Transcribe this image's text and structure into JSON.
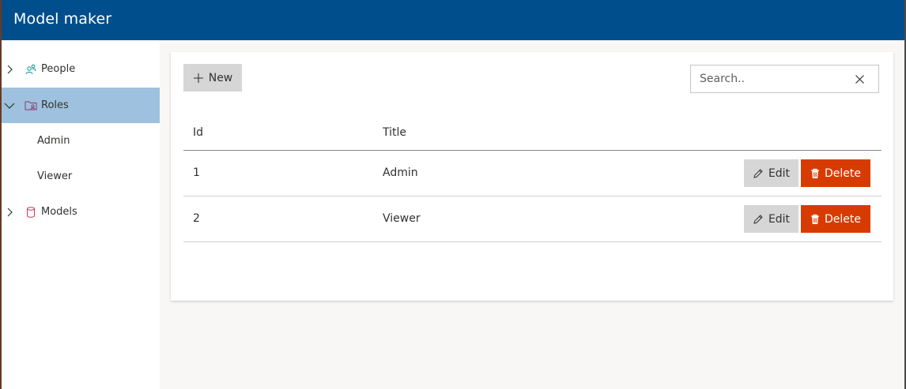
{
  "header": {
    "title": "Model maker"
  },
  "sidebar": {
    "items": [
      {
        "label": "People",
        "icon": "people-icon",
        "expanded": false,
        "selected": false
      },
      {
        "label": "Roles",
        "icon": "roles-icon",
        "expanded": true,
        "selected": true,
        "children": [
          {
            "label": "Admin"
          },
          {
            "label": "Viewer"
          }
        ]
      },
      {
        "label": "Models",
        "icon": "database-icon",
        "expanded": false,
        "selected": false
      }
    ]
  },
  "toolbar": {
    "new_label": "New"
  },
  "search": {
    "placeholder": "Search..",
    "value": ""
  },
  "table": {
    "columns": [
      "Id",
      "Title"
    ],
    "rows": [
      {
        "id": "1",
        "title": "Admin"
      },
      {
        "id": "2",
        "title": "Viewer"
      }
    ],
    "edit_label": "Edit",
    "delete_label": "Delete"
  },
  "colors": {
    "header": "#004e8c",
    "selected": "#9dc1de",
    "danger": "#d83b01",
    "neutral_button": "#d6d6d6"
  }
}
